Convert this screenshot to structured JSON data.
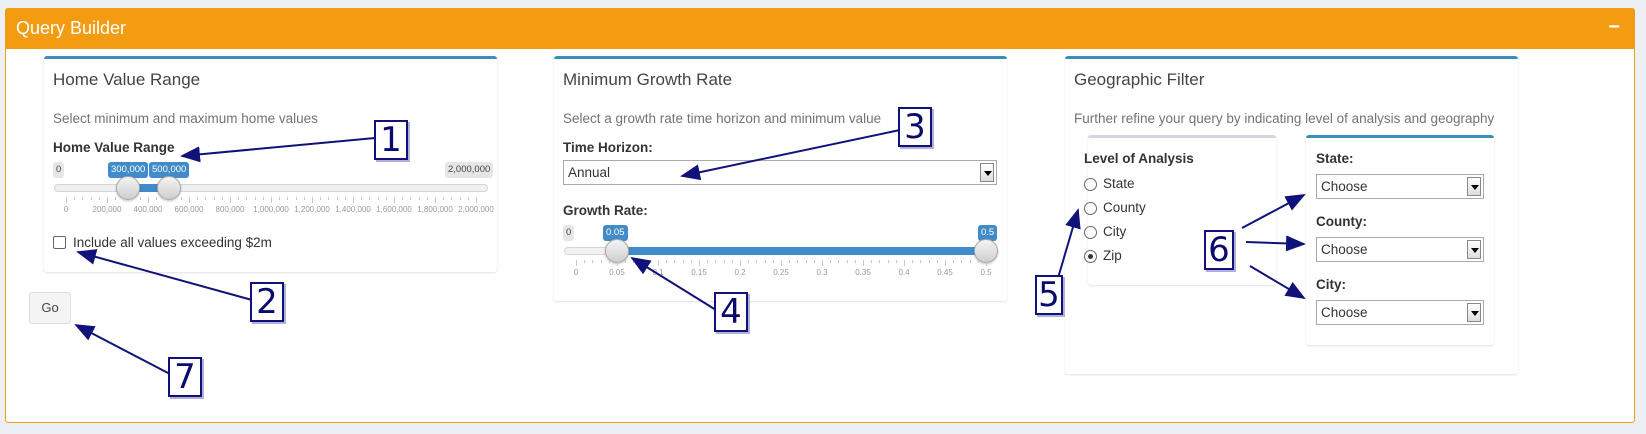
{
  "panel": {
    "title": "Query Builder",
    "collapse_icon": "−"
  },
  "home_value": {
    "title": "Home Value Range",
    "help": "Select minimum and maximum home values",
    "slider_label": "Home Value Range",
    "min_label": "0",
    "max_label": "2,000,000",
    "from_label": "300,000",
    "to_label": "500,000",
    "from_value": 300000,
    "to_value": 500000,
    "range_min": 0,
    "range_max": 2000000,
    "ticks": [
      "0",
      "200,000",
      "400,000",
      "600,000",
      "800,000",
      "1,000,000",
      "1,200,000",
      "1,400,000",
      "1,600,000",
      "1,800,000",
      "2,000,000"
    ],
    "checkbox_label": "Include all values exceeding $2m",
    "checkbox_checked": false
  },
  "go_button": "Go",
  "growth": {
    "title": "Minimum Growth Rate",
    "help": "Select a growth rate time horizon and minimum value",
    "horizon_label": "Time Horizon:",
    "horizon_value": "Annual",
    "rate_label": "Growth Rate:",
    "min_label": "0",
    "from_label": "0.05",
    "to_label": "0.5",
    "from_value": 0.05,
    "to_value": 0.5,
    "range_min": 0,
    "range_max": 0.5,
    "ticks": [
      "0",
      "0.05",
      "0.1",
      "0.15",
      "0.2",
      "0.25",
      "0.3",
      "0.35",
      "0.4",
      "0.45",
      "0.5"
    ]
  },
  "geo": {
    "title": "Geographic Filter",
    "help": "Further refine your query by indicating level of analysis and geography",
    "level_label": "Level of Analysis",
    "levels": [
      {
        "label": "State",
        "checked": false
      },
      {
        "label": "County",
        "checked": false
      },
      {
        "label": "City",
        "checked": false
      },
      {
        "label": "Zip",
        "checked": true
      }
    ],
    "state_label": "State:",
    "state_value": "Choose",
    "county_label": "County:",
    "county_value": "Choose",
    "city_label": "City:",
    "city_value": "Choose"
  },
  "callouts": [
    "1",
    "2",
    "3",
    "4",
    "5",
    "6",
    "7"
  ],
  "colors": {
    "header": "#f39c12",
    "accent": "#3c8dbc",
    "slider": "#428bca",
    "callout": "#0a0a6e"
  }
}
